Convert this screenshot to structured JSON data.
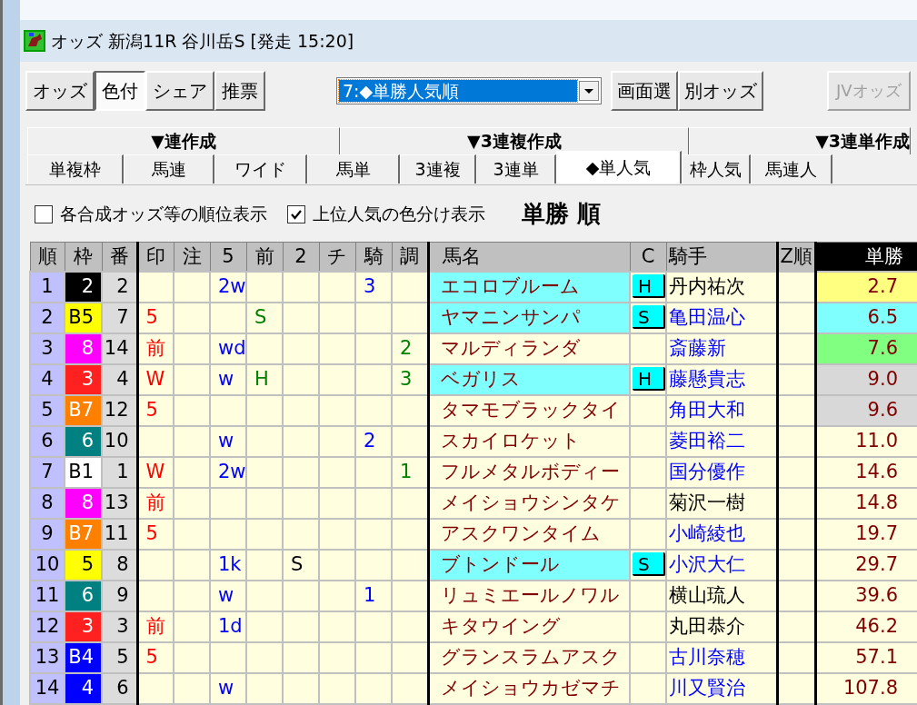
{
  "window": {
    "title": "オッズ 新潟11R 谷川岳S [発走 15:20]"
  },
  "toolbar": {
    "buttons": [
      {
        "label": "オッズ",
        "selected": false
      },
      {
        "label": "色付",
        "selected": true
      },
      {
        "label": "シェア",
        "selected": false
      },
      {
        "label": "推票",
        "selected": false
      }
    ],
    "dropdown": {
      "value": "7:◆単勝人気順"
    },
    "right_buttons": [
      {
        "label": "画面選",
        "disabled": false
      },
      {
        "label": "別オッズ",
        "disabled": false
      },
      {
        "label": "JVオッズ",
        "disabled": true
      }
    ]
  },
  "tab_groups": [
    "▼連作成",
    "▼3連複作成",
    "▼3連単作成"
  ],
  "tabs": [
    {
      "label": "単複枠",
      "selected": false
    },
    {
      "label": "馬連",
      "selected": false
    },
    {
      "label": "ワイド",
      "selected": false
    },
    {
      "label": "馬単",
      "selected": false
    },
    {
      "label": "3連複",
      "selected": false
    },
    {
      "label": "3連単",
      "selected": false
    },
    {
      "label": "◆単人気",
      "selected": true
    },
    {
      "label": "枠人気",
      "selected": false
    },
    {
      "label": "馬連人",
      "selected": false
    }
  ],
  "options": [
    {
      "label": "各合成オッズ等の順位表示",
      "checked": false
    },
    {
      "label": "上位人気の色分け表示",
      "checked": true
    }
  ],
  "heading": "単勝 順",
  "table": {
    "columns": [
      "順",
      "枠",
      "番",
      "印",
      "注",
      "5",
      "前",
      "2",
      "チ",
      "騎",
      "調",
      "馬名",
      "C",
      "騎手",
      "Z順",
      "単勝"
    ],
    "rows": [
      {
        "rank": "1",
        "waku": {
          "text": "2",
          "color": "#000000"
        },
        "number": "2",
        "col_5": "2w",
        "col_ki": "3",
        "name": {
          "text": "エコロブルーム",
          "highlighted": true
        },
        "c": "H",
        "jockey": {
          "text": "丹内祐次",
          "highlighted": false
        },
        "odds": {
          "text": "2.7",
          "color": "#ffff80"
        }
      },
      {
        "rank": "2",
        "waku": {
          "text": "B5",
          "color": "#ffff00"
        },
        "number": "7",
        "mark": "5",
        "col_mae": "S",
        "name": {
          "text": "ヤマニンサンパ",
          "highlighted": true
        },
        "c": "S",
        "jockey": {
          "text": "亀田温心",
          "highlighted": true
        },
        "odds": {
          "text": "6.5",
          "color": "#80ffff"
        }
      },
      {
        "rank": "3",
        "waku": {
          "text": "8",
          "color": "#ff00ff"
        },
        "number": "14",
        "mark": "前",
        "col_5": "wd",
        "col_cho": "2",
        "name": {
          "text": "マルディランダ",
          "highlighted": false
        },
        "jockey": {
          "text": "斎藤新",
          "highlighted": true
        },
        "odds": {
          "text": "7.6",
          "color": "#80ff80"
        }
      },
      {
        "rank": "4",
        "waku": {
          "text": "3",
          "color": "#ff2020"
        },
        "number": "4",
        "mark": "W",
        "col_5": "w",
        "col_mae": "H",
        "col_cho": "3",
        "name": {
          "text": "ベガリス",
          "highlighted": true
        },
        "c": "H",
        "jockey": {
          "text": "藤懸貴志",
          "highlighted": true
        },
        "odds": {
          "text": "9.0",
          "color": "#d8d8d8"
        }
      },
      {
        "rank": "5",
        "waku": {
          "text": "B7",
          "color": "#ff8000"
        },
        "number": "12",
        "mark": "5",
        "name": {
          "text": "タマモブラックタイ",
          "highlighted": false
        },
        "jockey": {
          "text": "角田大和",
          "highlighted": true
        },
        "odds": {
          "text": "9.6",
          "color": "#d8d8d8"
        }
      },
      {
        "rank": "6",
        "waku": {
          "text": "6",
          "color": "#008080"
        },
        "number": "10",
        "col_5": "w",
        "col_ki": "2",
        "name": {
          "text": "スカイロケット",
          "highlighted": false
        },
        "jockey": {
          "text": "菱田裕二",
          "highlighted": true
        },
        "odds": {
          "text": "11.0"
        }
      },
      {
        "rank": "7",
        "waku": {
          "text": "B1",
          "color": "#ffffff"
        },
        "number": "1",
        "mark": "W",
        "col_5": "2w",
        "col_cho": "1",
        "name": {
          "text": "フルメタルボディー",
          "highlighted": false
        },
        "jockey": {
          "text": "国分優作",
          "highlighted": true
        },
        "odds": {
          "text": "14.6"
        }
      },
      {
        "rank": "8",
        "waku": {
          "text": "8",
          "color": "#ff00ff"
        },
        "number": "13",
        "mark": "前",
        "name": {
          "text": "メイショウシンタケ",
          "highlighted": false
        },
        "jockey": {
          "text": "菊沢一樹",
          "highlighted": false
        },
        "odds": {
          "text": "14.8"
        }
      },
      {
        "rank": "9",
        "waku": {
          "text": "B7",
          "color": "#ff8000"
        },
        "number": "11",
        "mark": "5",
        "name": {
          "text": "アスクワンタイム",
          "highlighted": false
        },
        "jockey": {
          "text": "小崎綾也",
          "highlighted": true
        },
        "odds": {
          "text": "19.7"
        }
      },
      {
        "rank": "10",
        "waku": {
          "text": "5",
          "color": "#ffff00"
        },
        "number": "8",
        "col_5": "1k",
        "col_2": "S",
        "name": {
          "text": "ブトンドール",
          "highlighted": true
        },
        "c": "S",
        "jockey": {
          "text": "小沢大仁",
          "highlighted": true
        },
        "odds": {
          "text": "29.7"
        }
      },
      {
        "rank": "11",
        "waku": {
          "text": "6",
          "color": "#008080"
        },
        "number": "9",
        "col_5": "w",
        "col_ki": "1",
        "name": {
          "text": "リュミエールノワル",
          "highlighted": false
        },
        "jockey": {
          "text": "横山琉人",
          "highlighted": false
        },
        "odds": {
          "text": "39.6"
        }
      },
      {
        "rank": "12",
        "waku": {
          "text": "3",
          "color": "#ff2020"
        },
        "number": "3",
        "mark": "前",
        "col_5": "1d",
        "name": {
          "text": "キタウイング",
          "highlighted": false
        },
        "jockey": {
          "text": "丸田恭介",
          "highlighted": false
        },
        "odds": {
          "text": "46.2"
        }
      },
      {
        "rank": "13",
        "waku": {
          "text": "B4",
          "color": "#0000ff"
        },
        "number": "5",
        "mark": "5",
        "name": {
          "text": "グランスラムアスク",
          "highlighted": false
        },
        "jockey": {
          "text": "古川奈穂",
          "highlighted": true
        },
        "odds": {
          "text": "57.1"
        }
      },
      {
        "rank": "14",
        "waku": {
          "text": "4",
          "color": "#0000ff"
        },
        "number": "6",
        "col_5": "w",
        "name": {
          "text": "メイショウカゼマチ",
          "highlighted": false
        },
        "jockey": {
          "text": "川又賢治",
          "highlighted": true
        },
        "odds": {
          "text": "107.8"
        }
      }
    ]
  }
}
